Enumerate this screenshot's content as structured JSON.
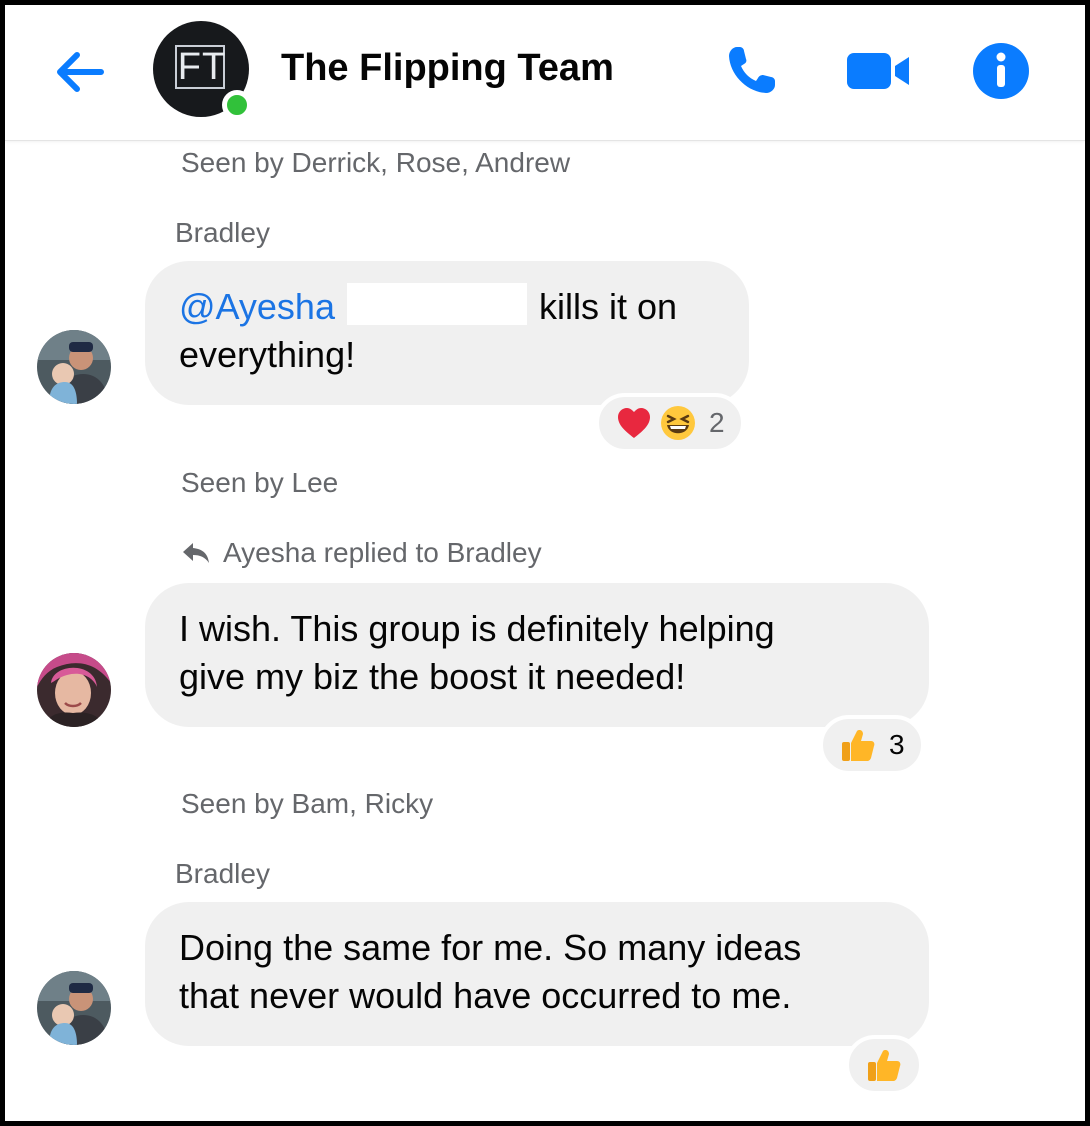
{
  "header": {
    "avatar_initials": "FT",
    "title": "The Flipping Team",
    "icons": [
      "back-arrow-icon",
      "phone-icon",
      "video-icon",
      "info-icon"
    ],
    "accent_color": "#0a7cff",
    "online_color": "#31c13a"
  },
  "messages": [
    {
      "seen_by": "Seen by Derrick, Rose, Andrew"
    },
    {
      "sender": "Bradley",
      "mention": "@Ayesha",
      "text_after_mention": "kills it on",
      "text_line2": "everything!",
      "reaction_count": "2",
      "reactions": [
        "heart-emoji",
        "laughing-emoji"
      ]
    },
    {
      "seen_by": "Seen by Lee",
      "reply_note": "Ayesha replied to Bradley",
      "text_line1": "I wish. This group is definitely helping",
      "text_line2": "give my biz the boost it needed!",
      "reaction_count": "3",
      "reactions": [
        "thumbs-up-emoji"
      ]
    },
    {
      "seen_by": "Seen by Bam, Ricky",
      "sender": "Bradley",
      "text_line1": "Doing the same for me. So many ideas",
      "text_line2": "that never would have occurred to me.",
      "reactions": [
        "thumbs-up-emoji"
      ]
    }
  ]
}
